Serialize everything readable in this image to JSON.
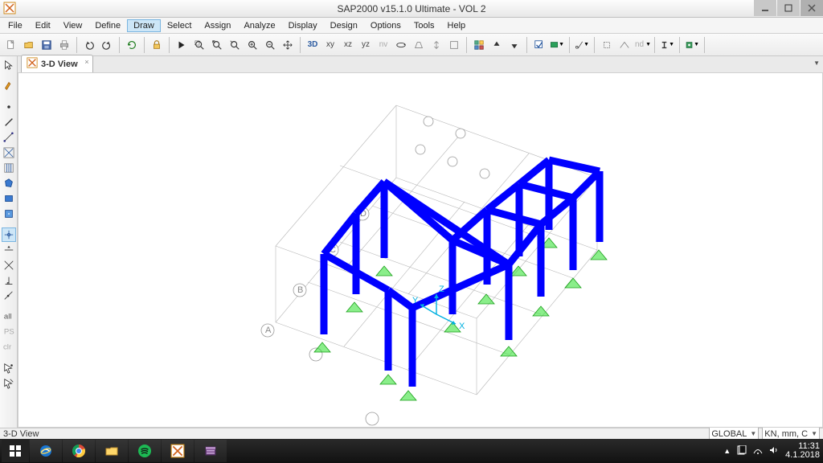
{
  "title": "SAP2000 v15.1.0 Ultimate  - VOL 2",
  "menu": [
    "File",
    "Edit",
    "View",
    "Define",
    "Draw",
    "Select",
    "Assign",
    "Analyze",
    "Display",
    "Design",
    "Options",
    "Tools",
    "Help"
  ],
  "menu_active_index": 4,
  "tab": {
    "label": "3-D View"
  },
  "status": {
    "left": "3-D View",
    "coord_sys": "GLOBAL",
    "units": "KN, mm, C"
  },
  "toolbar_labels": {
    "threeD": "3D",
    "xy": "xy",
    "xz": "xz",
    "yz": "yz",
    "nv": "nv",
    "nd": "nd"
  },
  "axis_labels": {
    "x": "X",
    "y": "Y",
    "z": "Z"
  },
  "taskbar": {
    "time": "11:31",
    "date": "4.1.2018"
  }
}
